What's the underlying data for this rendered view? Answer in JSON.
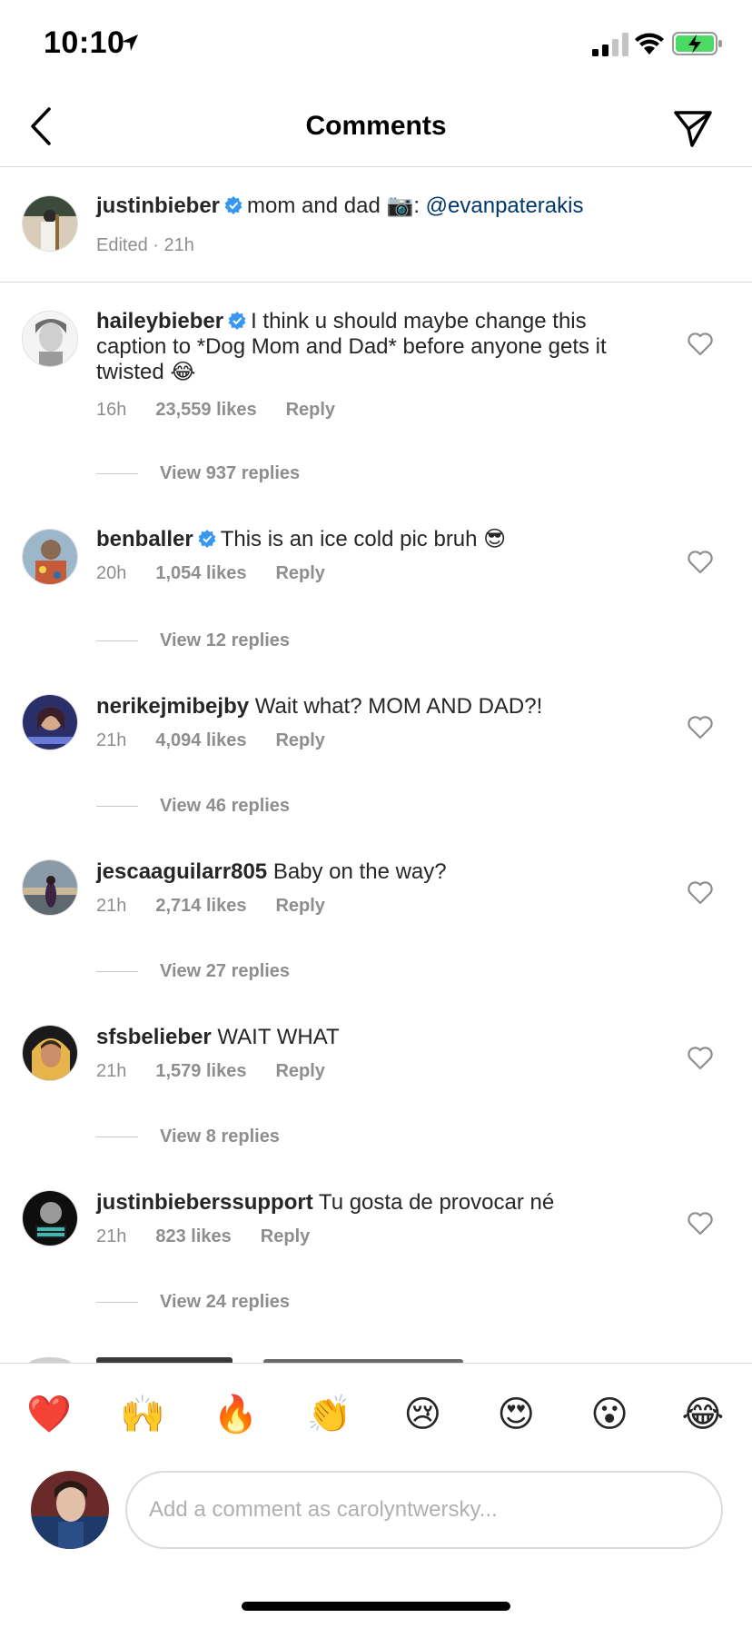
{
  "status_bar": {
    "time": "10:10"
  },
  "nav": {
    "title": "Comments"
  },
  "caption": {
    "username": "justinbieber",
    "text": "mom and dad 📷: ",
    "mention": "@evanpaterakis",
    "meta": "Edited · 21h"
  },
  "comments": [
    {
      "username": "haileybieber",
      "verified": true,
      "text": "I think u should maybe change this caption to *Dog Mom and Dad* before anyone gets it twisted 😂",
      "time": "16h",
      "likes": "23,559 likes",
      "reply": "Reply",
      "view_replies": "View 937 replies"
    },
    {
      "username": "benballer",
      "verified": true,
      "text": "This is an ice cold pic bruh 😎",
      "time": "20h",
      "likes": "1,054 likes",
      "reply": "Reply",
      "view_replies": "View 12 replies"
    },
    {
      "username": "nerikejmibejby",
      "verified": false,
      "text": "Wait what? MOM AND DAD?!",
      "time": "21h",
      "likes": "4,094 likes",
      "reply": "Reply",
      "view_replies": "View 46 replies"
    },
    {
      "username": "jescaaguilarr805",
      "verified": false,
      "text": "Baby on the way?",
      "time": "21h",
      "likes": "2,714 likes",
      "reply": "Reply",
      "view_replies": "View 27 replies"
    },
    {
      "username": "sfsbelieber",
      "verified": false,
      "text": "WAIT WHAT",
      "time": "21h",
      "likes": "1,579 likes",
      "reply": "Reply",
      "view_replies": "View 8 replies"
    },
    {
      "username": "justinbieberssupport",
      "verified": false,
      "text": "Tu gosta de provocar né",
      "time": "21h",
      "likes": "823 likes",
      "reply": "Reply",
      "view_replies": "View 24 replies"
    }
  ],
  "emoji_bar": [
    "❤️",
    "🙌",
    "🔥",
    "👏",
    "😢",
    "😍",
    "😮",
    "😂"
  ],
  "composer": {
    "placeholder": "Add a comment as carolyntwersky..."
  }
}
